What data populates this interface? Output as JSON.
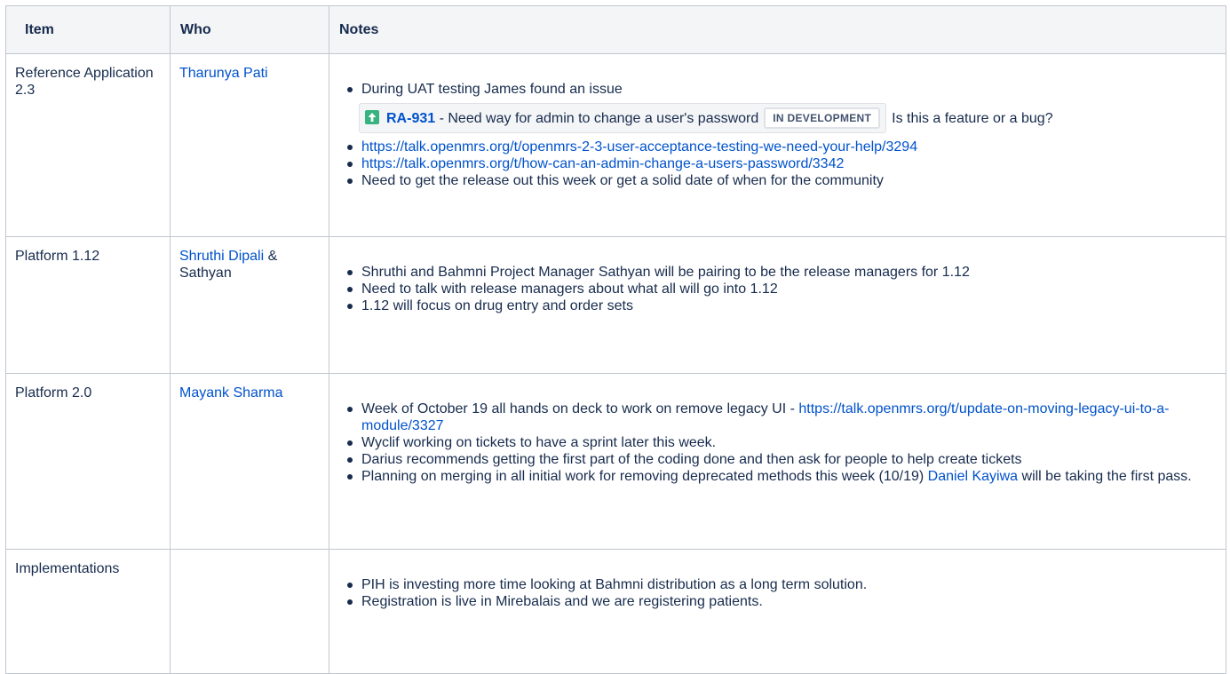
{
  "table": {
    "headers": {
      "item": "Item",
      "who": "Who",
      "notes": "Notes"
    },
    "rows": [
      {
        "item": "Reference Application 2.3",
        "who_link": "Tharunya Pati",
        "notes": {
          "n1": "During UAT testing James found an issue",
          "jira_key": "RA-931",
          "jira_summary": " - Need way for admin to change a user's password",
          "jira_status": "IN DEVELOPMENT",
          "jira_trail": "Is this a feature or a bug?",
          "link1": "https://talk.openmrs.org/t/openmrs-2-3-user-acceptance-testing-we-need-your-help/3294",
          "link2": "https://talk.openmrs.org/t/how-can-an-admin-change-a-users-password/3342",
          "n4": "Need to get the release out this week or get a solid date of when for the community"
        }
      },
      {
        "item": "Platform 1.12",
        "who_link": "Shruthi Dipali",
        "who_suffix": " & Sathyan",
        "notes": {
          "n1": "Shruthi and Bahmni Project Manager Sathyan will be pairing to be the release managers for 1.12",
          "n2": "Need to talk with release managers about what all will go into 1.12",
          "n3": "1.12 will focus on drug entry and order sets"
        }
      },
      {
        "item": "Platform 2.0",
        "who_link": "Mayank Sharma",
        "notes": {
          "n1_text": "Week of October 19 all hands on deck to work on remove legacy UI - ",
          "n1_link": "https://talk.openmrs.org/t/update-on-moving-legacy-ui-to-a-module/3327",
          "n2": "Wyclif working on tickets to have a sprint later this week.",
          "n3": "Darius recommends getting the first part of the coding done and then ask for people to help create tickets",
          "n4_text": "Planning on merging in all initial work for removing deprecated methods this week (10/19) ",
          "n4_link": "Daniel Kayiwa",
          "n4_tail": " will be taking the first pass."
        }
      },
      {
        "item": "Implementations",
        "notes": {
          "n1": "PIH is investing more time looking at Bahmni distribution as a long term solution.",
          "n2": "Registration is live in Mirebalais and we are registering patients."
        }
      }
    ]
  },
  "colors": {
    "link": "#0052cc",
    "header_bg": "#f4f5f7",
    "border": "#c1c7d0",
    "jira_icon": "#36b37e"
  },
  "icons": {
    "jira_priority": "arrow-up-icon"
  }
}
